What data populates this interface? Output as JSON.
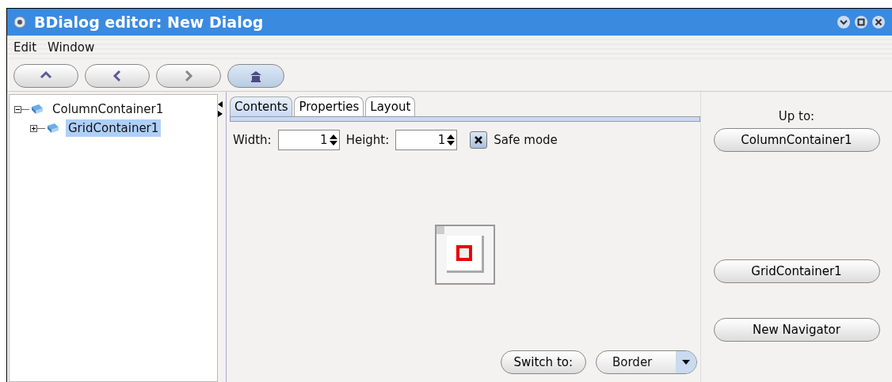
{
  "window": {
    "title": "BDialog editor: New Dialog"
  },
  "menu": [
    "Edit",
    "Window"
  ],
  "toolbar": [
    {
      "kind": "up"
    },
    {
      "kind": "back"
    },
    {
      "kind": "forward"
    },
    {
      "kind": "home"
    }
  ],
  "tree": [
    {
      "label": "ColumnContainer1",
      "expanded": true,
      "selected": false,
      "children": [
        {
          "label": "GridContainer1",
          "expanded": false,
          "selected": true
        }
      ]
    }
  ],
  "tabs": [
    {
      "label": "Contents",
      "selected": true
    },
    {
      "label": "Properties",
      "selected": false
    },
    {
      "label": "Layout",
      "selected": false
    }
  ],
  "fields": [
    {
      "label": "Width:",
      "value": "1"
    },
    {
      "label": "Height:",
      "value": "1"
    }
  ],
  "safe_mode": {
    "label": "Safe mode",
    "checked": true
  },
  "switch_button": "Switch to:",
  "layout_select": {
    "value": "Border"
  },
  "right_panel": {
    "heading": "Up to:",
    "buttons": [
      "ColumnContainer1",
      "GridContainer1"
    ],
    "new_button": "New Navigator"
  }
}
